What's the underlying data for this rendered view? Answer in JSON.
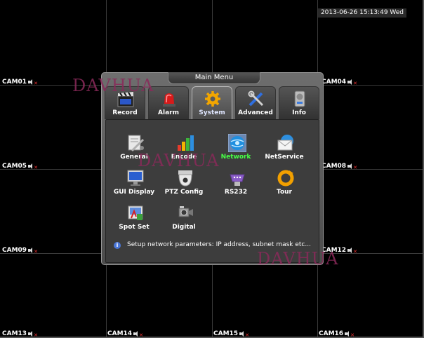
{
  "clock": "2013-06-26 15:13:49 Wed",
  "cameras": [
    "CAM01",
    "CAM04",
    "CAM05",
    "CAM08",
    "CAM09",
    "CAM12",
    "CAM13",
    "CAM14",
    "CAM15",
    "CAM16"
  ],
  "watermark": "DAVHUA",
  "menu": {
    "title": "Main Menu",
    "tabs": [
      {
        "label": "Record",
        "icon": "record-icon"
      },
      {
        "label": "Alarm",
        "icon": "alarm-icon"
      },
      {
        "label": "System",
        "icon": "gear-icon"
      },
      {
        "label": "Advanced",
        "icon": "tools-icon"
      },
      {
        "label": "Info",
        "icon": "info-drive-icon"
      }
    ],
    "active_tab": "System",
    "items": [
      {
        "label": "General",
        "icon": "general-icon"
      },
      {
        "label": "Encode",
        "icon": "encode-icon"
      },
      {
        "label": "Network",
        "icon": "network-globe-icon"
      },
      {
        "label": "NetService",
        "icon": "netservice-mail-icon"
      },
      {
        "label": "GUI Display",
        "icon": "monitor-icon"
      },
      {
        "label": "PTZ Config",
        "icon": "ptz-camera-icon"
      },
      {
        "label": "RS232",
        "icon": "serial-connector-icon"
      },
      {
        "label": "Tour",
        "icon": "tour-cycle-icon"
      },
      {
        "label": "Spot Set",
        "icon": "spot-set-icon"
      },
      {
        "label": "Digital",
        "icon": "digital-camera-icon"
      }
    ],
    "active_item": "Network",
    "status": "Setup network parameters: IP address, subnet mask etc..."
  },
  "colors": {
    "active_item": "#46ff46",
    "watermark": "#8a2a5a",
    "background": "#000000"
  }
}
